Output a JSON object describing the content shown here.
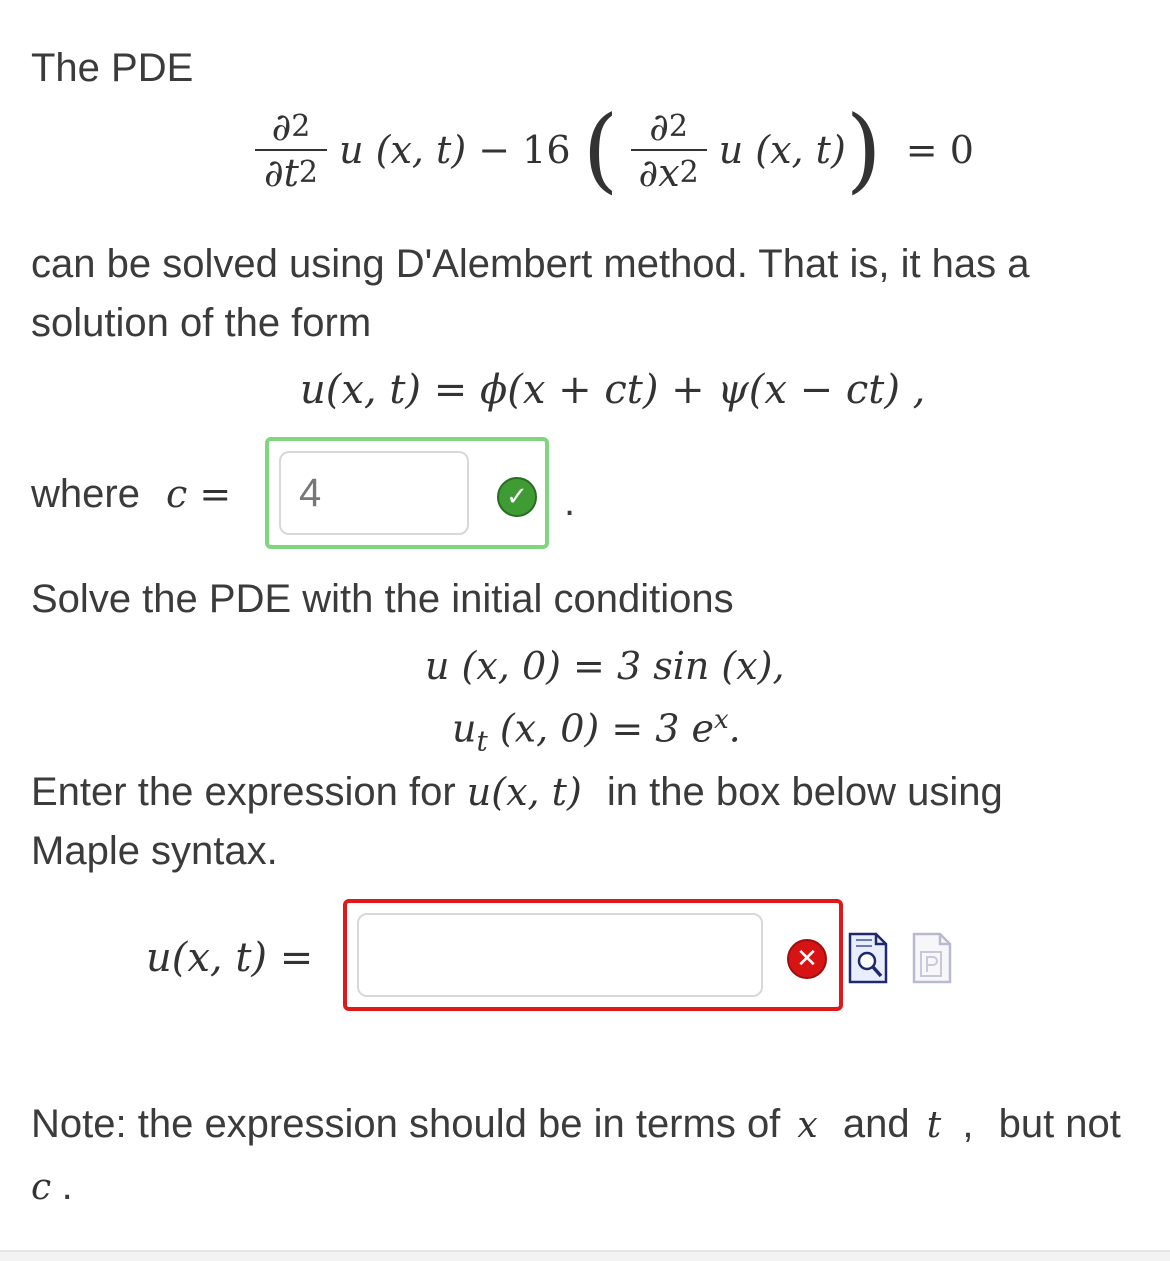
{
  "intro": {
    "the_pde": "The PDE",
    "pde": {
      "partial": "∂",
      "exp2": "2",
      "t_sq": "t",
      "x_sq": "x",
      "u_xt": "u (x, t)",
      "minus_16": "− 16",
      "equals_zero": "= 0"
    },
    "dalembert_line1": "can be solved using D'Alembert method. That is, it has a",
    "dalembert_line2": "solution of the form",
    "solution_form": "u(x, t) = ϕ(x + ct) + ψ(x − ct) ,"
  },
  "c_question": {
    "label": "where",
    "math": "c =",
    "value": "4",
    "status": "correct",
    "trailing": "."
  },
  "initial": {
    "heading": "Solve the PDE with the initial conditions",
    "cond1": "u (x, 0) = 3 sin (x),",
    "cond2_lhs": "u",
    "cond2_sub": "t",
    "cond2_rhs": " (x, 0) = 3 e",
    "cond2_sup": "x",
    "cond2_end": "."
  },
  "enter": {
    "line1_pre": "Enter the expression for",
    "line1_math": "u(x, t)",
    "line1_post": "in the box below using",
    "line2": "Maple syntax."
  },
  "u_answer": {
    "label": "u(x, t) =",
    "value": "",
    "status": "incorrect"
  },
  "note": {
    "pre": "Note: the expression should be in terms of",
    "x": "x",
    "and": "and",
    "t": "t",
    "comma": ",",
    "post": "but not",
    "c": "c",
    "end": "."
  },
  "icons": [
    "checkmark-icon",
    "error-x-icon",
    "preview-icon",
    "maple-syntax-icon"
  ],
  "colors": {
    "correct_border": "#7fd67f",
    "incorrect_border": "#e01818",
    "correct_icon": "#3f9c35",
    "incorrect_icon": "#d61414"
  }
}
